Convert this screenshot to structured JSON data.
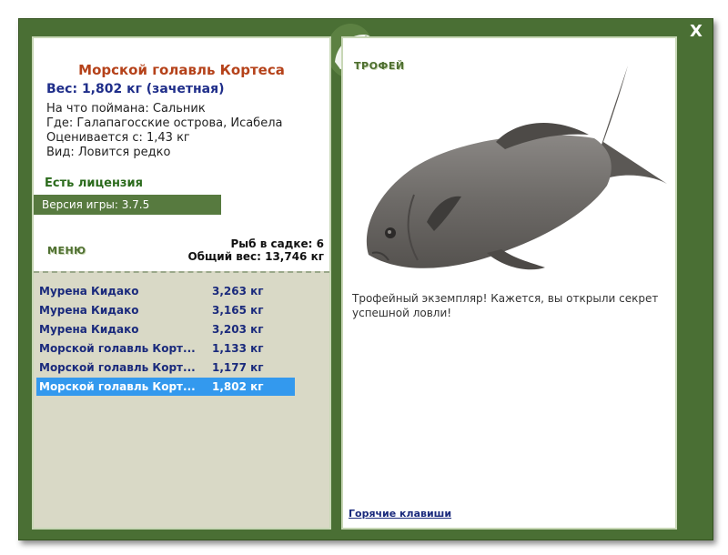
{
  "window": {
    "close_label": "X"
  },
  "fish": {
    "name": "Морской голавль Кортеса",
    "weight_line": "Вес: 1,802 кг (зачетная)",
    "caught_on": "На что поймана: Сальник",
    "location": "Где: Галапагосские острова, Исабела",
    "valued_from": "Оценивается с: 1,43 кг",
    "rarity": "Вид: Ловится редко"
  },
  "license": "Есть лицензия",
  "version": "Версия игры: 3.7.5",
  "menu_label": "МЕНЮ",
  "creel": {
    "count": "Рыб в садке: 6",
    "total_weight": "Общий вес: 13,746 кг",
    "items": [
      {
        "name": "Мурена Кидако",
        "weight": "3,263 кг",
        "selected": false
      },
      {
        "name": "Мурена Кидако",
        "weight": "3,165 кг",
        "selected": false
      },
      {
        "name": "Мурена Кидако",
        "weight": "3,203 кг",
        "selected": false
      },
      {
        "name": "Морской голавль Корт...",
        "weight": "1,133 кг",
        "selected": false
      },
      {
        "name": "Морской голавль Корт...",
        "weight": "1,177 кг",
        "selected": false
      },
      {
        "name": "Морской голавль Корт...",
        "weight": "1,802 кг",
        "selected": true
      }
    ]
  },
  "trophy": {
    "label": "ТРОФЕЙ",
    "text": "Трофейный экземпляр! Кажется, вы открыли секрет успешной ловли!"
  },
  "hotkeys_link": "Горячие клавиши",
  "colors": {
    "frame_green": "#4a6f34",
    "title_orange": "#b5421a",
    "weight_blue": "#1f2e8a",
    "selection_blue": "#3399ee",
    "list_bg": "#d9d9c6"
  },
  "icons": {
    "logo": "fish-logo-icon",
    "fish": "trophy-fish-image"
  }
}
